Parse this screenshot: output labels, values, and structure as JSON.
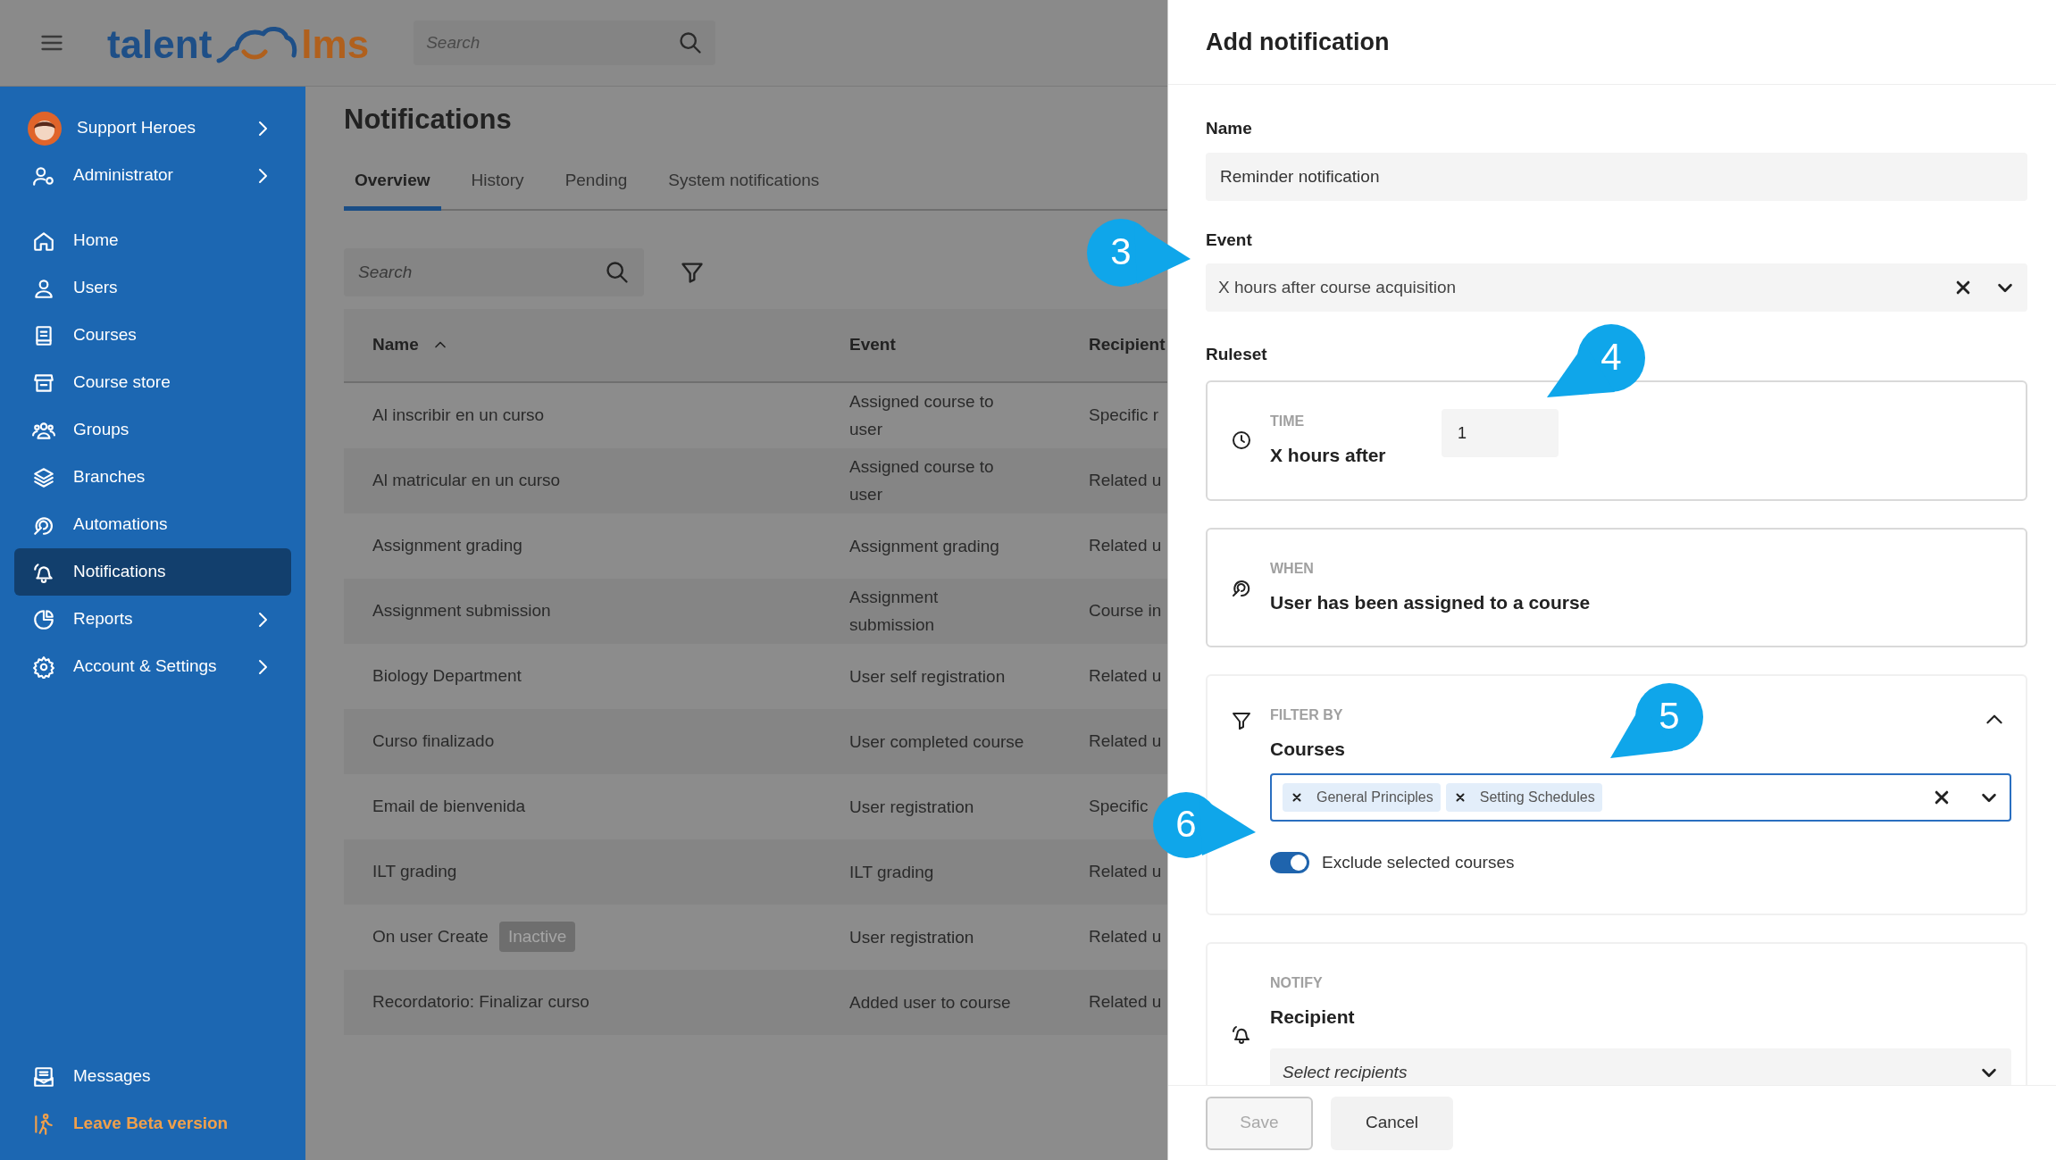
{
  "topbar": {
    "logo_left": "talent",
    "logo_right": "lms",
    "search_placeholder": "Search"
  },
  "sidebar": {
    "account": {
      "label": "Support Heroes",
      "has_submenu": true
    },
    "role": {
      "label": "Administrator",
      "has_submenu": true
    },
    "items": [
      {
        "label": "Home",
        "selected": false,
        "has_submenu": false
      },
      {
        "label": "Users",
        "selected": false,
        "has_submenu": false
      },
      {
        "label": "Courses",
        "selected": false,
        "has_submenu": false
      },
      {
        "label": "Course store",
        "selected": false,
        "has_submenu": false
      },
      {
        "label": "Groups",
        "selected": false,
        "has_submenu": false
      },
      {
        "label": "Branches",
        "selected": false,
        "has_submenu": false
      },
      {
        "label": "Automations",
        "selected": false,
        "has_submenu": false
      },
      {
        "label": "Notifications",
        "selected": true,
        "has_submenu": false
      },
      {
        "label": "Reports",
        "selected": false,
        "has_submenu": true
      },
      {
        "label": "Account & Settings",
        "selected": false,
        "has_submenu": true
      }
    ],
    "bottom": [
      {
        "label": "Messages",
        "kind": "normal"
      },
      {
        "label": "Leave Beta version",
        "kind": "accent"
      }
    ]
  },
  "page": {
    "title": "Notifications",
    "tabs": [
      {
        "label": "Overview",
        "selected": true
      },
      {
        "label": "History",
        "selected": false
      },
      {
        "label": "Pending",
        "selected": false
      },
      {
        "label": "System notifications",
        "selected": false
      }
    ],
    "search_placeholder": "Search",
    "table": {
      "columns": [
        {
          "label": "Name",
          "sorted": true
        },
        {
          "label": "Event",
          "sorted": false
        },
        {
          "label": "Recipient",
          "sorted": false
        }
      ],
      "rows": [
        {
          "name": "Al inscribir en un curso",
          "event": "Assigned course to user",
          "recipient": "Specific r"
        },
        {
          "name": "Al matricular en un curso",
          "event": "Assigned course to user",
          "recipient": "Related u"
        },
        {
          "name": "Assignment grading",
          "event": "Assignment grading",
          "recipient": "Related u"
        },
        {
          "name": "Assignment submission",
          "event": "Assignment submission",
          "recipient": "Course in"
        },
        {
          "name": "Biology Department",
          "event": "User self registration",
          "recipient": "Related u"
        },
        {
          "name": "Curso finalizado",
          "event": "User completed course",
          "recipient": "Related u"
        },
        {
          "name": "Email de bienvenida",
          "event": "User registration",
          "recipient": "Specific"
        },
        {
          "name": "ILT grading",
          "event": "ILT grading",
          "recipient": "Related u"
        },
        {
          "name": "On user Create",
          "badge": "Inactive",
          "event": "User registration",
          "recipient": "Related u"
        },
        {
          "name": "Recordatorio: Finalizar curso",
          "event": "Added user to course",
          "recipient": "Related u"
        }
      ]
    }
  },
  "drawer": {
    "title": "Add notification",
    "name_field": {
      "label": "Name",
      "value": "Reminder notification"
    },
    "event_field": {
      "label": "Event",
      "value": "X hours after course acquisition"
    },
    "ruleset_label": "Ruleset",
    "cards": [
      {
        "kind": "time",
        "overline": "TIME",
        "title": "X hours after",
        "value": "1"
      },
      {
        "kind": "when",
        "overline": "WHEN",
        "title": "User has been assigned to a course"
      },
      {
        "kind": "filter",
        "overline": "FILTER BY",
        "title": "Courses",
        "expanded": true,
        "tags": [
          "General Principles",
          "Setting Schedules"
        ],
        "toggle": {
          "label": "Exclude selected courses",
          "on": true
        }
      },
      {
        "kind": "notify",
        "overline": "NOTIFY",
        "title": "Recipient",
        "placeholder": "Select recipients"
      }
    ],
    "buttons": [
      {
        "label": "Save",
        "disabled": true
      },
      {
        "label": "Cancel",
        "disabled": false
      }
    ]
  },
  "callouts": [
    {
      "label": "3"
    },
    {
      "label": "4"
    },
    {
      "label": "5"
    },
    {
      "label": "6"
    }
  ]
}
